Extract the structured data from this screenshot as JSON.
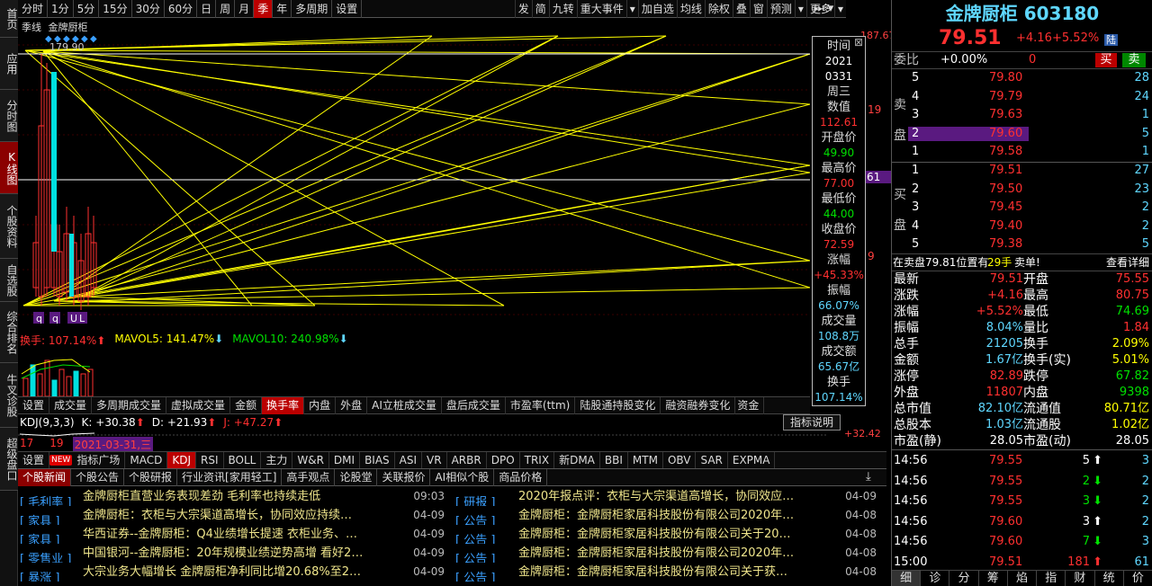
{
  "left_tabs": [
    {
      "label": "首页",
      "active": false
    },
    {
      "label": "应用",
      "active": false
    },
    {
      "label": "分时图",
      "active": false
    },
    {
      "label": "K线图",
      "active": true
    },
    {
      "label": "个股资料",
      "active": false
    },
    {
      "label": "自选股",
      "active": false
    },
    {
      "label": "综合排名",
      "active": false
    },
    {
      "label": "牛叉诊股",
      "active": false
    },
    {
      "label": "超级盘口",
      "active": false
    }
  ],
  "periods": [
    "分时",
    "1分",
    "5分",
    "15分",
    "30分",
    "60分",
    "日",
    "周",
    "月",
    "季",
    "年",
    "多周期",
    "设置"
  ],
  "active_period": "季",
  "tools": [
    "发",
    "简",
    "九转",
    "重大事件",
    "▾",
    "加自选",
    "均线",
    "除权",
    "叠",
    "窗",
    "预测",
    "▾",
    "更多",
    "▾"
  ],
  "chart": {
    "period_label": "季线",
    "stock_label": "金牌厨柜",
    "max_label": "179.90",
    "axis_top": "187.67",
    "axis_mid": "19",
    "axis_price": "61",
    "axis_low": "9",
    "markers": [
      "q",
      "q",
      "U",
      "L"
    ]
  },
  "popup": {
    "time_label": "时间",
    "date_year": "2021",
    "date_md": "0331",
    "weekday": "周三",
    "value_label": "数值",
    "value": "112.61",
    "open_label": "开盘价",
    "open": "49.90",
    "high_label": "最高价",
    "high": "77.00",
    "low_label": "最低价",
    "low": "44.00",
    "close_label": "收盘价",
    "close": "72.59",
    "change_label": "涨幅",
    "change": "+45.33%",
    "amp_label": "振幅",
    "amp": "66.07%",
    "vol_label": "成交量",
    "vol": "108.8万",
    "amount_label": "成交额",
    "amount": "65.67亿",
    "turn_label": "换手",
    "turn": "107.14%"
  },
  "volinfo": {
    "turn": "换手: 107.14%",
    "mavol5": "MAVOL5: 141.47%",
    "mavol10": "MAVOL10: 240.98%"
  },
  "ind_tabs": [
    "设置",
    "成交量",
    "多周期成交量",
    "虚拟成交量",
    "金额",
    "换手率",
    "内盘",
    "外盘",
    "AI立桩成交量",
    "盘后成交量",
    "市盈率(ttm)",
    "陆股通持股变化",
    "融资融券变化",
    "资金",
    "指标说明"
  ],
  "active_ind": "换手率",
  "kdj": {
    "label": "KDJ(9,3,3)",
    "k": "K: +30.38",
    "d": "D: +21.93",
    "j": "J: +47.27",
    "right_val": "+32.42"
  },
  "datebar": {
    "a": "17",
    "b": "19",
    "date": "2021-03-31,三"
  },
  "kdj_tabs": [
    "设置",
    "NEW",
    "指标广场",
    "MACD",
    "KDJ",
    "RSI",
    "BOLL",
    "主力",
    "W&R",
    "DMI",
    "BIAS",
    "ASI",
    "VR",
    "ARBR",
    "DPO",
    "TRIX",
    "新DMA",
    "BBI",
    "MTM",
    "OBV",
    "SAR",
    "EXPMA"
  ],
  "active_kdj": "KDJ",
  "news_tabs": [
    "个股新闻",
    "个股公告",
    "个股研报",
    "行业资讯[家用轻工]",
    "高手观点",
    "论股堂",
    "关联报价",
    "AI相似个股",
    "商品价格"
  ],
  "news_left": [
    {
      "cat": "[ 毛利率 ]",
      "title": "金牌厨柜直营业务表现差劲 毛利率也持续走低",
      "time": "09:03"
    },
    {
      "cat": "[ 家具 ]",
      "title": "金牌厨柜：衣柜与大宗渠道高增长，协同效应持续…",
      "time": "04-09"
    },
    {
      "cat": "[ 家具 ]",
      "title": "华西证券--金牌厨柜：Q4业绩增长提速 衣柜业务、…",
      "time": "04-09"
    },
    {
      "cat": "[ 零售业 ]",
      "title": "中国银河--金牌厨柜：20年规模业绩逆势高增 看好2…",
      "time": "04-09"
    },
    {
      "cat": "[ 暴涨 ]",
      "title": "大宗业务大幅增长 金牌厨柜净利同比增20.68%至2…",
      "time": "04-09"
    }
  ],
  "news_right": [
    {
      "cat": "[ 研报 ]",
      "title": "2020年报点评：衣柜与大宗渠道高增长，协同效应…",
      "time": "04-09"
    },
    {
      "cat": "[ 公告 ]",
      "title": "金牌厨柜：金牌厨柜家居科技股份有限公司2020年…",
      "time": "04-08"
    },
    {
      "cat": "[ 公告 ]",
      "title": "金牌厨柜：金牌厨柜家居科技股份有限公司关于20…",
      "time": "04-08"
    },
    {
      "cat": "[ 公告 ]",
      "title": "金牌厨柜：金牌厨柜家居科技股份有限公司2020年…",
      "time": "04-08"
    },
    {
      "cat": "[ 公告 ]",
      "title": "金牌厨柜：金牌厨柜家居科技股份有限公司关于获…",
      "time": "04-08"
    }
  ],
  "quote": {
    "name_code": "金牌厨柜 603180",
    "price": "79.51",
    "change": "+4.16",
    "pct": "+5.52%",
    "badge": "陆",
    "weibi_label": "委比",
    "weibi": "+0.00%",
    "weicha": "0",
    "buy_btn": "买",
    "sell_btn": "卖"
  },
  "sell_side_label": [
    "卖",
    "盘"
  ],
  "buy_side_label": [
    "买",
    "盘"
  ],
  "asks": [
    {
      "lvl": "5",
      "price": "79.80",
      "vol": "28"
    },
    {
      "lvl": "4",
      "price": "79.79",
      "vol": "24"
    },
    {
      "lvl": "3",
      "price": "79.63",
      "vol": "1"
    },
    {
      "lvl": "2",
      "price": "79.60",
      "vol": "5"
    },
    {
      "lvl": "1",
      "price": "79.58",
      "vol": "1"
    }
  ],
  "bids": [
    {
      "lvl": "1",
      "price": "79.51",
      "vol": "27"
    },
    {
      "lvl": "2",
      "price": "79.50",
      "vol": "23"
    },
    {
      "lvl": "3",
      "price": "79.45",
      "vol": "2"
    },
    {
      "lvl": "4",
      "price": "79.40",
      "vol": "2"
    },
    {
      "lvl": "5",
      "price": "79.38",
      "vol": "5"
    }
  ],
  "notice": {
    "text": "在卖盘79.81位置有",
    "qty": "29手",
    "tail": "卖单!",
    "link": "查看详细"
  },
  "stats": [
    [
      "最新",
      "79.51",
      "开盘",
      "75.55"
    ],
    [
      "涨跌",
      "+4.16",
      "最高",
      "80.75"
    ],
    [
      "涨幅",
      "+5.52%",
      "最低",
      "74.69"
    ],
    [
      "振幅",
      "8.04%",
      "量比",
      "1.84"
    ],
    [
      "总手",
      "21205",
      "换手",
      "2.09%"
    ],
    [
      "金额",
      "1.67亿",
      "换手(实)",
      "5.01%"
    ],
    [
      "涨停",
      "82.89",
      "跌停",
      "67.82"
    ],
    [
      "外盘",
      "11807",
      "内盘",
      "9398"
    ],
    [
      "总市值",
      "82.10亿",
      "流通值",
      "80.71亿"
    ],
    [
      "总股本",
      "1.03亿",
      "流通股",
      "1.02亿"
    ],
    [
      "市盈(静)",
      "28.05",
      "市盈(动)",
      "28.05"
    ]
  ],
  "ticks": [
    {
      "time": "14:56",
      "price": "79.55",
      "vol": "5",
      "dir": "up",
      "n": "3"
    },
    {
      "time": "14:56",
      "price": "79.55",
      "vol": "2",
      "dir": "down",
      "n": "2"
    },
    {
      "time": "14:56",
      "price": "79.55",
      "vol": "3",
      "dir": "down",
      "n": "2"
    },
    {
      "time": "14:56",
      "price": "79.60",
      "vol": "3",
      "dir": "up",
      "n": "2"
    },
    {
      "time": "14:56",
      "price": "79.60",
      "vol": "7",
      "dir": "down",
      "n": "3"
    },
    {
      "time": "15:00",
      "price": "79.51",
      "vol": "181",
      "dir": "up",
      "n": "61"
    }
  ],
  "bottom_tabs": [
    "细",
    "诊",
    "分",
    "筹",
    "焰",
    "指",
    "财",
    "统",
    "价"
  ]
}
